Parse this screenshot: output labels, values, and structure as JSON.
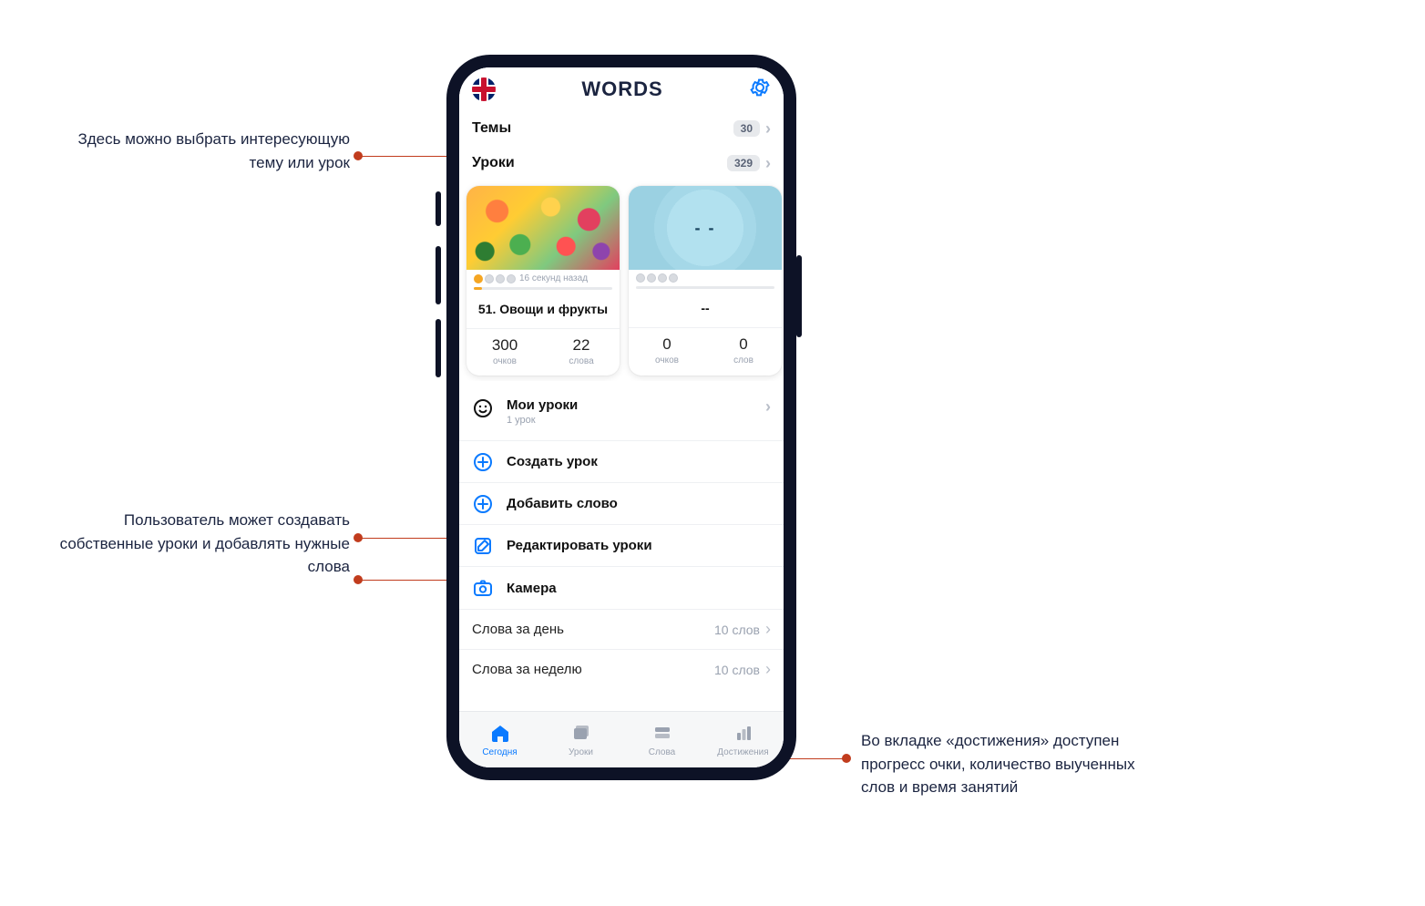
{
  "annotations": {
    "left1": "Здесь можно выбрать интересующую тему или урок",
    "left2": "Пользователь может создавать собственные уроки и добавлять нужные слова",
    "right1": "Во вкладке «достижения» доступен прогресс очки, количество выученных слов и время занятий"
  },
  "header": {
    "title": "WORDS"
  },
  "nav": {
    "themes_label": "Темы",
    "themes_count": "30",
    "lessons_label": "Уроки",
    "lessons_count": "329"
  },
  "cards": [
    {
      "time_ago": "16 секунд назад",
      "title": "51. Овощи и фрукты",
      "stat1_num": "300",
      "stat1_lbl": "очков",
      "stat2_num": "22",
      "stat2_lbl": "слова"
    },
    {
      "time_ago": "",
      "title": "--",
      "placeholder_img_text": "- -",
      "stat1_num": "0",
      "stat1_lbl": "очков",
      "stat2_num": "0",
      "stat2_lbl": "слов"
    }
  ],
  "actions": {
    "my_lessons": "Мои уроки",
    "my_lessons_sub": "1 урок",
    "create_lesson": "Создать урок",
    "add_word": "Добавить слово",
    "edit_lessons": "Редактировать уроки",
    "camera": "Камера"
  },
  "stats": {
    "per_day_label": "Слова за день",
    "per_day_value": "10 слов",
    "per_week_label": "Слова за неделю",
    "per_week_value": "10 слов"
  },
  "tabs": {
    "today": "Сегодня",
    "lessons": "Уроки",
    "words": "Слова",
    "achievements": "Достижения"
  }
}
